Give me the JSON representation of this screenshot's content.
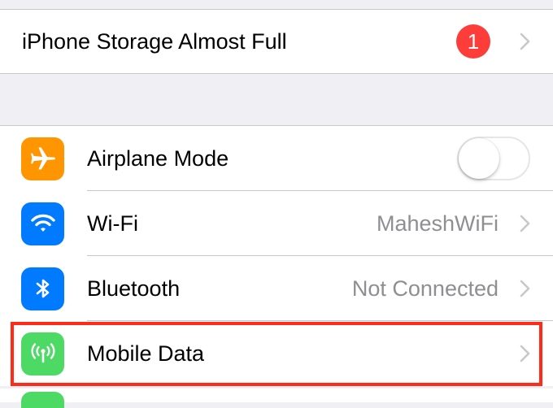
{
  "storage_alert": {
    "title": "iPhone Storage Almost Full",
    "badge_count": "1"
  },
  "settings": {
    "airplane": {
      "label": "Airplane Mode",
      "icon": "airplane-icon",
      "icon_color": "#ff9500",
      "toggle_on": false
    },
    "wifi": {
      "label": "Wi-Fi",
      "value": "MaheshWiFi",
      "icon": "wifi-icon",
      "icon_color": "#007aff"
    },
    "bluetooth": {
      "label": "Bluetooth",
      "value": "Not Connected",
      "icon": "bluetooth-icon",
      "icon_color": "#007aff"
    },
    "mobile_data": {
      "label": "Mobile Data",
      "icon": "antenna-icon",
      "icon_color": "#4cd964",
      "highlighted": true
    }
  },
  "colors": {
    "badge": "#fc3d39",
    "highlight_border": "#ff2a17",
    "secondary_text": "#8e8e93",
    "background": "#efeff4"
  }
}
